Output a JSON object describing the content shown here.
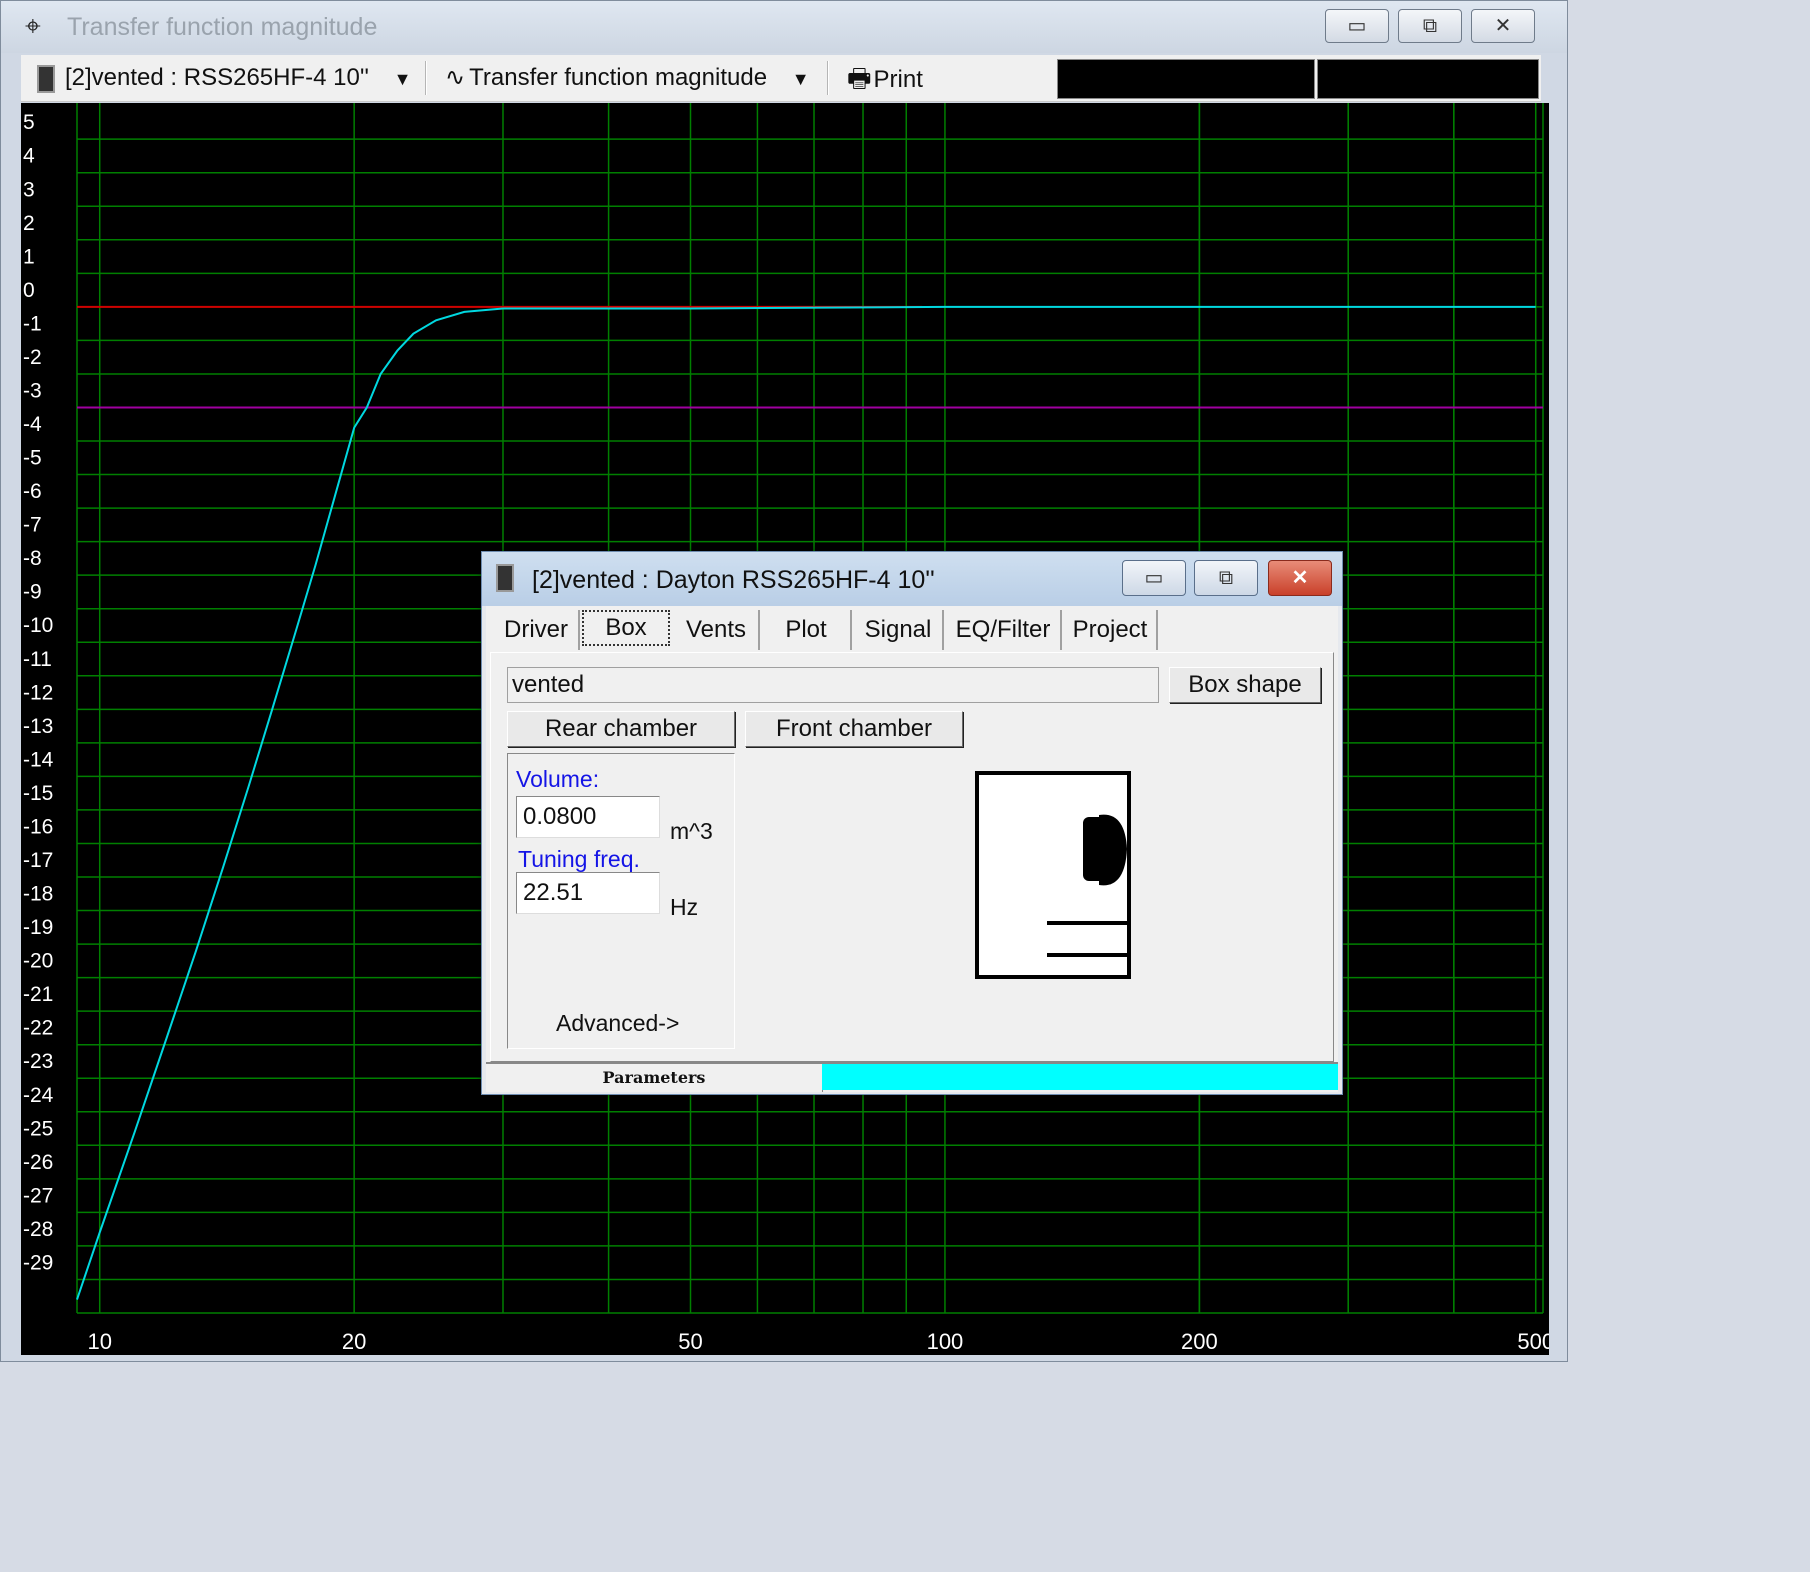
{
  "window": {
    "title": "Transfer function magnitude",
    "minimize_glyph": "▭",
    "restore_glyph": "⧉",
    "close_glyph": "✕"
  },
  "toolbar": {
    "project_select": "[2]vented : RSS265HF-4 10''",
    "graph_select": "Transfer function magnitude",
    "print_label": "Print"
  },
  "colors": {
    "grid": "#007f00",
    "response": "#00d8e0",
    "reference": "#d00000",
    "minus3": "#a000a0",
    "axis_text": "#ffffff"
  },
  "chart_data": {
    "type": "line",
    "x_scale": "log",
    "xlim": [
      9.4,
      510
    ],
    "ylim": [
      -30,
      5.9
    ],
    "x_ticks": [
      10,
      20,
      50,
      100,
      200,
      500
    ],
    "y_ticks": [
      5,
      4,
      3,
      2,
      1,
      0,
      -1,
      -2,
      -3,
      -4,
      -5,
      -6,
      -7,
      -8,
      -9,
      -10,
      -11,
      -12,
      -13,
      -14,
      -15,
      -16,
      -17,
      -18,
      -19,
      -20,
      -21,
      -22,
      -23,
      -24,
      -25,
      -26,
      -27,
      -28,
      -29
    ],
    "grid": true,
    "series": [
      {
        "color": "#00d8e0",
        "x": [
          9.4,
          10,
          11,
          12,
          13,
          14,
          15,
          16,
          17,
          18,
          19,
          20,
          20.7,
          21.5,
          22.5,
          23.5,
          25,
          27,
          30,
          35,
          50,
          100,
          200,
          500
        ],
        "y": [
          -29.6,
          -27.6,
          -24.6,
          -21.8,
          -19.2,
          -16.7,
          -14.3,
          -12.0,
          -9.8,
          -7.7,
          -5.6,
          -3.6,
          -3.0,
          -2.0,
          -1.3,
          -0.8,
          -0.4,
          -0.15,
          -0.05,
          -0.05,
          -0.05,
          0,
          0,
          0
        ]
      },
      {
        "color": "#d00000",
        "x": [
          9.4,
          94
        ],
        "y": [
          0,
          0
        ]
      },
      {
        "color": "#a000a0",
        "x": [
          9.4,
          510
        ],
        "y": [
          -3,
          -3
        ]
      }
    ]
  },
  "dialog": {
    "title": "[2]vented : Dayton RSS265HF-4 10''",
    "tabs": [
      "Driver",
      "Box",
      "Vents",
      "Plot",
      "Signal",
      "EQ/Filter",
      "Project"
    ],
    "active_tab": "Box",
    "box_name": "vented",
    "box_shape_button": "Box shape",
    "rear_chamber_button": "Rear chamber",
    "front_chamber_button": "Front chamber",
    "volume_label": "Volume:",
    "volume_value": "0.0800",
    "volume_unit": "m^3",
    "tuning_label": "Tuning freq.",
    "tuning_value": "22.51",
    "tuning_unit": "Hz",
    "advanced_button": "Advanced->",
    "status_label": "Parameters",
    "status_color": "#00ffff"
  }
}
